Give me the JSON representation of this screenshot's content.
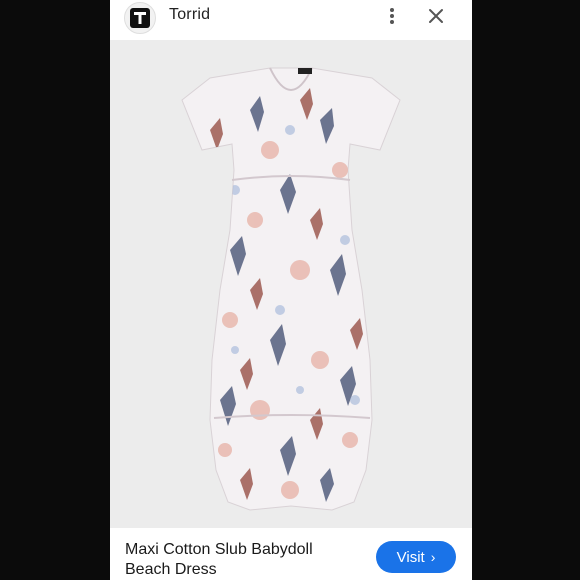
{
  "header": {
    "brand_name": "Torrid",
    "logo_letter": "T",
    "menu_icon": "more-vert-icon",
    "close_icon": "close-icon"
  },
  "product": {
    "title": "Maxi Cotton Slub Babydoll Beach Dress",
    "tag_text": "TORRID",
    "visit_label": "Visit",
    "visit_icon": "chevron-right-icon"
  },
  "colors": {
    "accent": "#1a73e8",
    "image_background": "#ececec",
    "dress_base": "#f4f1f3"
  }
}
